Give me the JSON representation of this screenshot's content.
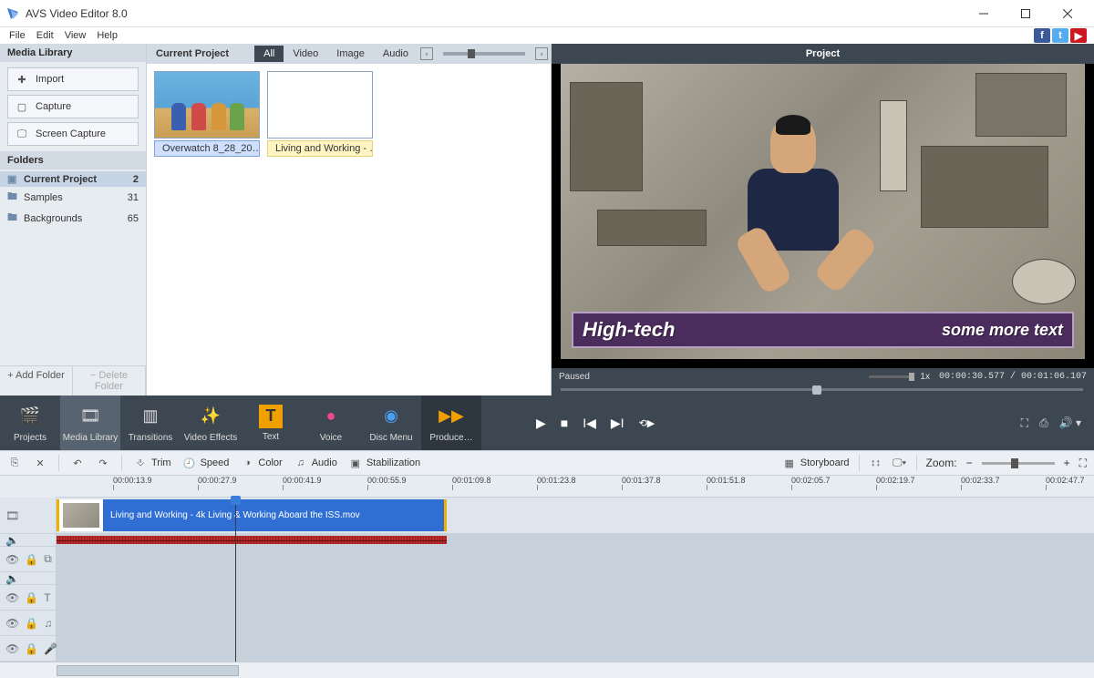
{
  "window": {
    "title": "AVS Video Editor 8.0"
  },
  "menu": {
    "items": [
      "File",
      "Edit",
      "View",
      "Help"
    ]
  },
  "social": {
    "facebook": "f",
    "twitter": "t",
    "youtube": "▶"
  },
  "left": {
    "media_library": "Media Library",
    "import": "Import",
    "capture": "Capture",
    "screen_capture": "Screen Capture",
    "folders_header": "Folders",
    "folders": [
      {
        "name": "Current Project",
        "count": "2",
        "selected": true
      },
      {
        "name": "Samples",
        "count": "31",
        "selected": false
      },
      {
        "name": "Backgrounds",
        "count": "65",
        "selected": false
      }
    ],
    "add_folder": "+ Add Folder",
    "delete_folder": "− Delete Folder"
  },
  "media": {
    "current_project": "Current Project",
    "filters": {
      "all": "All",
      "video": "Video",
      "image": "Image",
      "audio": "Audio"
    },
    "items": [
      {
        "label": "Overwatch 8_28_20…",
        "kind": "video"
      },
      {
        "label": "Living and Working - …",
        "kind": "video"
      }
    ]
  },
  "preview": {
    "header": "Project",
    "status": "Paused",
    "speed": "1x",
    "timecode": "00:00:30.577  /  00:01:06.107",
    "caption_left": "High-tech",
    "caption_right": "some more text"
  },
  "toolbar": {
    "projects": "Projects",
    "media_library": "Media Library",
    "transitions": "Transitions",
    "video_effects": "Video Effects",
    "text": "Text",
    "voice": "Voice",
    "disc_menu": "Disc Menu",
    "produce": "Produce…"
  },
  "edit": {
    "trim": "Trim",
    "speed": "Speed",
    "color": "Color",
    "audio": "Audio",
    "stabilization": "Stabilization",
    "storyboard": "Storyboard",
    "zoom": "Zoom:"
  },
  "timeline": {
    "ticks": [
      "00:00:13.9",
      "00:00:27.9",
      "00:00:41.9",
      "00:00:55.9",
      "00:01:09.8",
      "00:01:23.8",
      "00:01:37.8",
      "00:01:51.8",
      "00:02:05.7",
      "00:02:19.7",
      "00:02:33.7",
      "00:02:47.7"
    ],
    "clip_name": "Living and Working - 4k Living & Working Aboard the ISS.mov"
  }
}
